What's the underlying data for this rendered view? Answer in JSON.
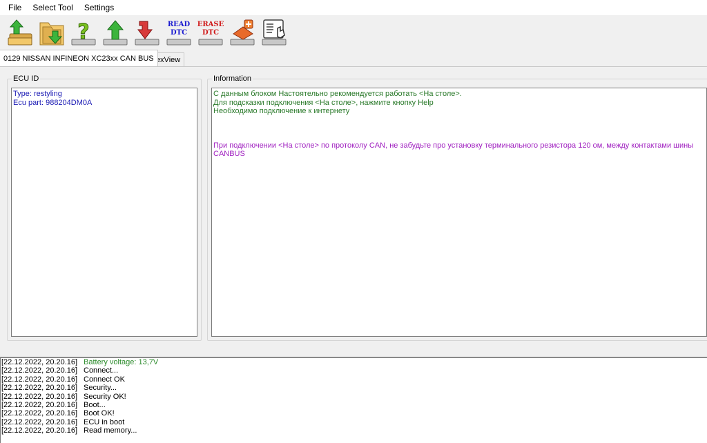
{
  "menu": {
    "file": "File",
    "select_tool": "Select Tool",
    "settings": "Settings"
  },
  "toolbar": {
    "buttons": [
      {
        "icon": "open-folder-upload-icon"
      },
      {
        "icon": "folder-green-arrow-icon"
      },
      {
        "icon": "help-question-icon"
      },
      {
        "icon": "upload-green-arrow-icon"
      },
      {
        "icon": "download-red-arrow-icon"
      },
      {
        "icon": "read-dtc-icon",
        "line1": "READ",
        "line2": "DTC"
      },
      {
        "icon": "erase-dtc-icon",
        "line1": "ERASE",
        "line2": "DTC"
      },
      {
        "icon": "add-chip-icon"
      },
      {
        "icon": "manual-book-icon"
      }
    ]
  },
  "tabs": {
    "active": "0129 NISSAN INFINEON XC23xx CAN BUS",
    "hexview": "HexView"
  },
  "ecu_id": {
    "title": "ECU ID",
    "type": "Type: restyling",
    "part": "Ecu part: 988204DM0A"
  },
  "information": {
    "title": "Information",
    "line1": "С данным блоком Настоятельно рекомендуется работать <На столе>.",
    "line2": "Для подсказки подключения <На столе>, нажмите кнопку Help",
    "line3": "Необходимо подключение к интернету",
    "line4": "При подключении  <На столе> по протоколу CAN, не забудьте про установку терминального резистора 120 ом, между контактами шины CANBUS"
  },
  "log": [
    {
      "time": "[22.12.2022, 20.20.16]",
      "msg": "Battery voltage: 13,7V"
    },
    {
      "time": "[22.12.2022, 20.20.16]",
      "msg": "Connect..."
    },
    {
      "time": "[22.12.2022, 20.20.16]",
      "msg": "Connect OK"
    },
    {
      "time": "[22.12.2022, 20.20.16]",
      "msg": "Security..."
    },
    {
      "time": "[22.12.2022, 20.20.16]",
      "msg": "Security OK!"
    },
    {
      "time": "[22.12.2022, 20.20.16]",
      "msg": "Boot..."
    },
    {
      "time": "[22.12.2022, 20.20.16]",
      "msg": "Boot OK!"
    },
    {
      "time": "[22.12.2022, 20.20.16]",
      "msg": "ECU in boot"
    },
    {
      "time": "[22.12.2022, 20.20.16]",
      "msg": "Read memory..."
    }
  ],
  "colors": {
    "ecu_text": "#1a1ab4",
    "info_text": "#2a7a2a",
    "warning_text": "#a020c0",
    "battery_text": "#2a8a2a",
    "read_dtc": "#1a1ad0",
    "erase_dtc": "#d01a1a"
  }
}
